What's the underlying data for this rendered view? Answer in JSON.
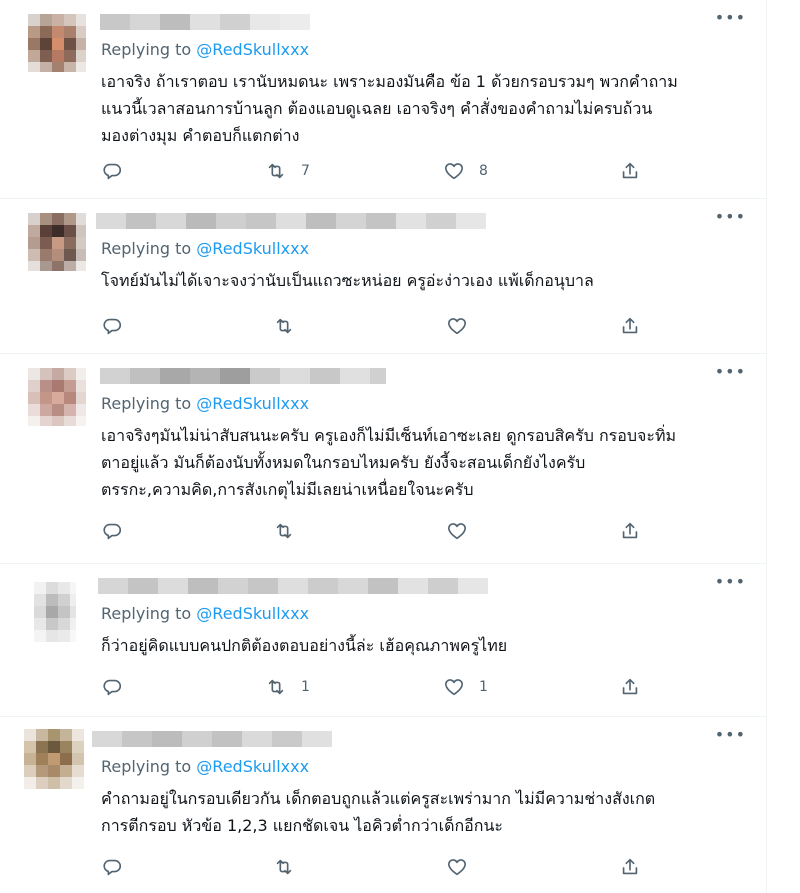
{
  "replying_label": "Replying to ",
  "replies": [
    {
      "handle": "@RedSkullxxx",
      "lines": [
        "เอาจริง ถ้าเราตอบ เรานับหมดนะ เพราะมองมันคือ ข้อ 1 ด้วยกรอบรวมๆ พวกคำถาม",
        "แนวนี้เวลาสอนการบ้านลูก ต้องแอบดูเฉลย เอาจริงๆ คำสั่งของคำถามไม่ครบถ้วน",
        "มองต่างมุม คำตอบก็แตกต่าง"
      ],
      "retweet_count": "7",
      "like_count": "8"
    },
    {
      "handle": "@RedSkullxxx",
      "lines": [
        "โจทย์มันไม่ได้เจาะจงว่านับเป็นแถวซะหน่อย ครูอ่ะง่าวเอง แพ้เด็กอนุบาล"
      ],
      "retweet_count": "",
      "like_count": ""
    },
    {
      "handle": "@RedSkullxxx",
      "lines": [
        "เอาจริงๆมันไม่น่าสับสนนะครับ ครูเองก็ไม่มีเซ็นท์เอาซะเลย ดูกรอบสิครับ กรอบจะทิ่ม",
        "ตาอยู่แล้ว มันก็ต้องนับทั้งหมดในกรอบไหมครับ ยังงี้จะสอนเด็กยังไงครับ",
        "ตรรกะ,ความคิด,การสังเกตุไม่มีเลยน่าเหนื่อยใจนะครับ"
      ],
      "retweet_count": "",
      "like_count": ""
    },
    {
      "handle": "@RedSkullxxx",
      "lines": [
        "ก็ว่าอยู่คิดแบบคนปกติต้องตอบอย่างนี้ล่ะ เฮ้อคุณภาพครูไทย"
      ],
      "retweet_count": "1",
      "like_count": "1"
    },
    {
      "handle": "@RedSkullxxx",
      "lines": [
        "คำถามอยู่ในกรอบเดียวกัน เด็กตอบถูกแล้วแต่ครูสะเพร่ามาก ไม่มีความช่างสังเกต",
        "การตีกรอบ หัวข้อ 1,2,3 แยกชัดเจน ไอคิวต่ำกว่าเด็กอีกนะ"
      ],
      "retweet_count": "",
      "like_count": ""
    }
  ],
  "icons": {
    "more": "more-icon",
    "reply": "reply-icon",
    "retweet": "retweet-icon",
    "like": "like-icon",
    "share": "share-icon"
  },
  "colors": {
    "link": "#1d9bf0",
    "secondary": "#536471",
    "text": "#0f1419",
    "divider": "#eff3f4"
  }
}
